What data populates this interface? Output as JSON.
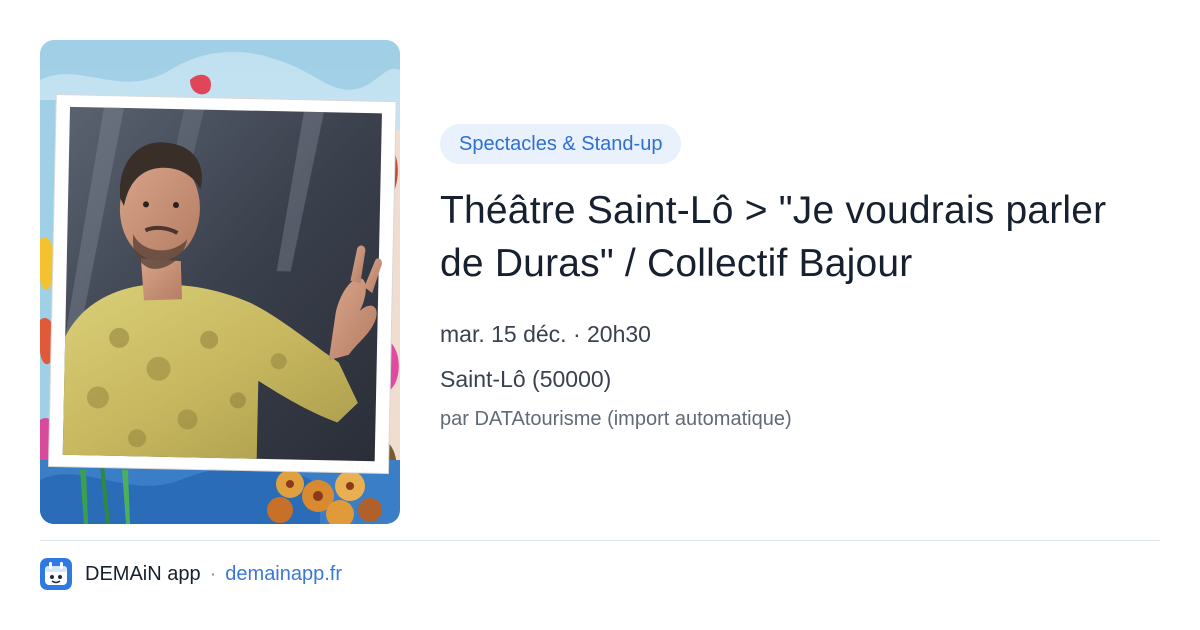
{
  "event": {
    "category": "Spectacles & Stand-up",
    "title": "Théâtre Saint-Lô > \"Je voudrais parler de Duras\" / Collectif Bajour",
    "date": "mar. 15 déc. · 20h30",
    "location": "Saint-Lô (50000)",
    "source": "par DATAtourisme (import automatique)"
  },
  "footer": {
    "app_name": "DEMAiN app",
    "separator": "·",
    "domain": "demainapp.fr"
  },
  "colors": {
    "accent": "#3b78d8",
    "pill_bg": "#e9f1fc",
    "pill_text": "#2f6fd0",
    "title": "#16202e",
    "muted": "#616a76",
    "app_icon": "#2d7be0"
  },
  "icons": {
    "app": "demain-app-icon"
  }
}
